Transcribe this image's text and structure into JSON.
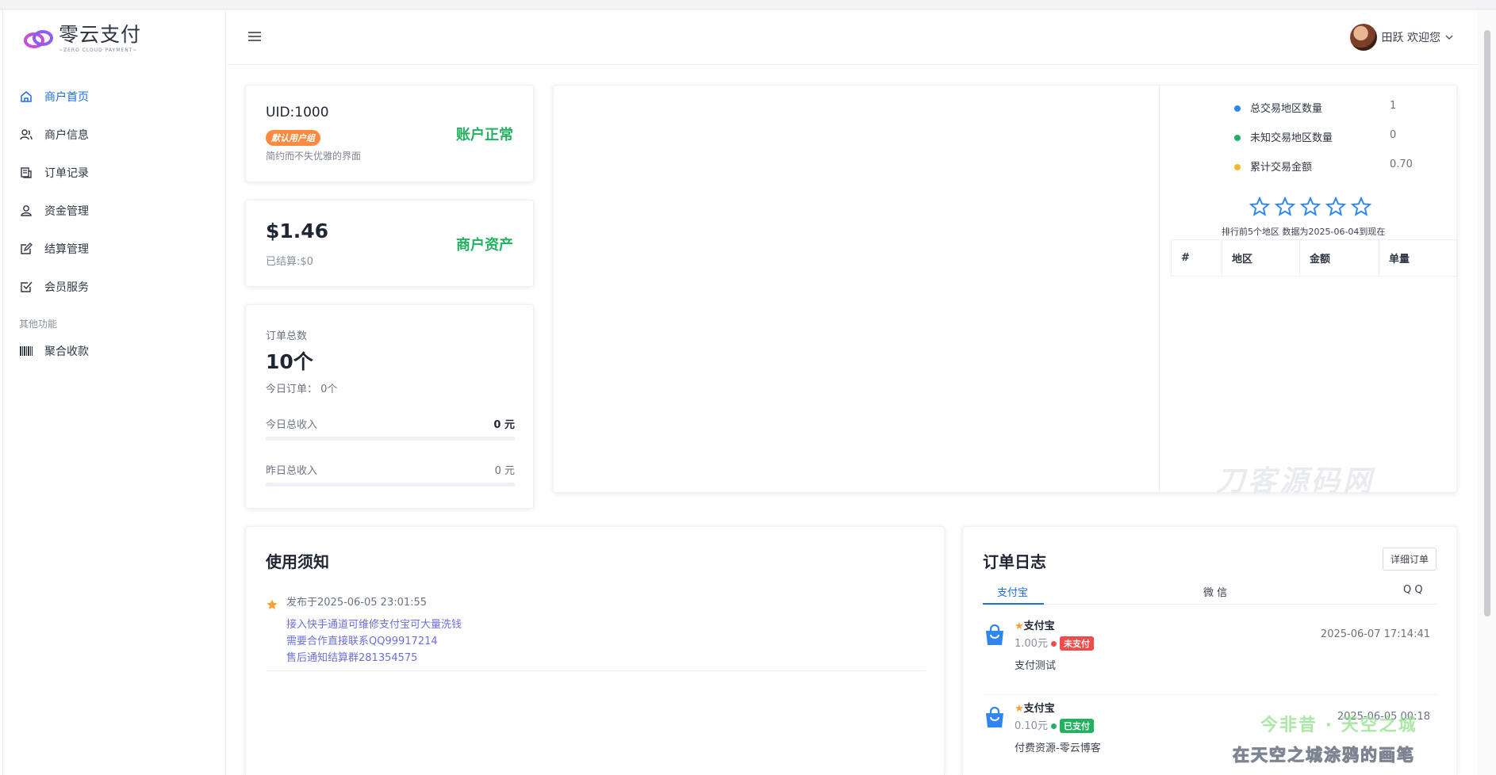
{
  "brand": {
    "title": "零云支付",
    "subtitle": "~ZERO CLOUD PAYMENT~"
  },
  "sidebar": {
    "items": [
      {
        "label": "商户首页",
        "icon": "home-icon",
        "active": true
      },
      {
        "label": "商户信息",
        "icon": "users-icon",
        "active": false
      },
      {
        "label": "订单记录",
        "icon": "receipt-icon",
        "active": false
      },
      {
        "label": "资金管理",
        "icon": "wallet-user-icon",
        "active": false
      },
      {
        "label": "结算管理",
        "icon": "edit-icon",
        "active": false
      },
      {
        "label": "会员服务",
        "icon": "check-square-icon",
        "active": false
      }
    ],
    "section_label": "其他功能",
    "extra_items": [
      {
        "label": "聚合收款",
        "icon": "barcode-icon"
      }
    ]
  },
  "header": {
    "user_greeting": "田跃 欢迎您"
  },
  "account": {
    "uid": "UID:1000",
    "group": "默认用户组",
    "desc": "简约而不失优雅的界面",
    "status": "账户正常"
  },
  "asset": {
    "amount": "$1.46",
    "settled": "已结算:$0",
    "label": "商户资产"
  },
  "orders": {
    "label": "订单总数",
    "count": "10个",
    "today_orders": "今日订单： 0个",
    "today_income_label": "今日总收入",
    "today_income_value": "0 元",
    "yesterday_income_label": "昨日总收入",
    "yesterday_income_value": "0 元"
  },
  "map": {
    "watermark": "刀客源码网",
    "legend": [
      {
        "label": "总交易地区数量",
        "value": "1",
        "color": "#2f86f0"
      },
      {
        "label": "未知交易地区数量",
        "value": "0",
        "color": "#21b15f"
      },
      {
        "label": "累计交易金额",
        "value": "0.70",
        "color": "#f5b82e"
      }
    ],
    "stars": 5,
    "rank_note": "排行前5个地区  数据为2025-06-04到现在",
    "rank_headers": [
      "#",
      "地区",
      "金额",
      "单量"
    ]
  },
  "notice": {
    "title": "使用须知",
    "date": "发布于2025-06-05 23:01:55",
    "lines": [
      "接入快手通道可维修支付宝可大量洗钱",
      "需要合作直接联系QQ99917214",
      "售后通知结算群281354575"
    ]
  },
  "order_log": {
    "title": "订单日志",
    "detail_btn": "详细订单",
    "tabs": [
      "支付宝",
      "微 信",
      "Q Q"
    ],
    "items": [
      {
        "name": "支付宝",
        "amount": "1.00元",
        "status": "未支付",
        "status_color": "#ef4c4c",
        "time": "2025-06-07 17:14:41",
        "desc": "支付测试"
      },
      {
        "name": "支付宝",
        "amount": "0.10元",
        "status": "已支付",
        "status_color": "#21b15f",
        "time": "2025-06-05 00:18",
        "desc": "付费资源-零云博客"
      }
    ],
    "overlay_1": "今非昔 · 天空之城",
    "overlay_2": "在天空之城涂鸦的画笔"
  }
}
